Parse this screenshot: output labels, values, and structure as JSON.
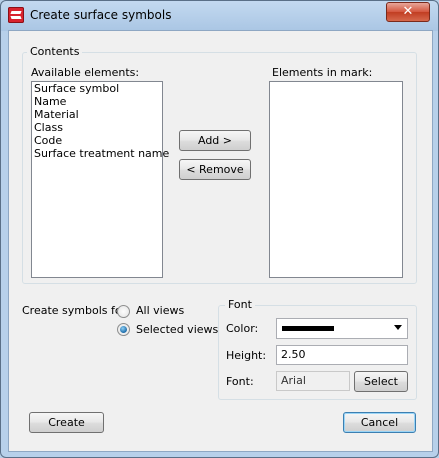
{
  "window": {
    "title": "Create surface symbols",
    "close_glyph": "✕",
    "icon": "app-icon"
  },
  "contents": {
    "group_label": "Contents",
    "available_label": "Available elements:",
    "available_items": [
      "Surface symbol",
      "Name",
      "Material",
      "Class",
      "Code",
      "Surface treatment name"
    ],
    "elements_label": "Elements in mark:",
    "elements_items": [],
    "add_button": "Add >",
    "remove_button": "< Remove"
  },
  "create_for": {
    "label": "Create symbols for:",
    "options": [
      {
        "label": "All views",
        "checked": false
      },
      {
        "label": "Selected views",
        "checked": true
      }
    ]
  },
  "font": {
    "group_label": "Font",
    "color_label": "Color:",
    "color_value": "#000000",
    "height_label": "Height:",
    "height_value": "2.50",
    "font_label": "Font:",
    "font_value": "Arial",
    "select_button": "Select"
  },
  "footer": {
    "create_button": "Create",
    "cancel_button": "Cancel"
  }
}
